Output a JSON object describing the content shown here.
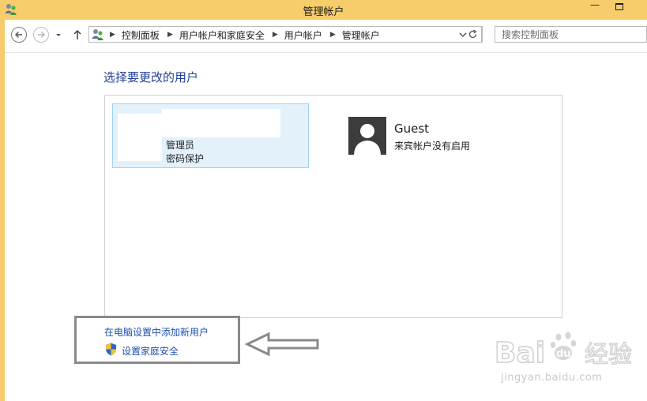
{
  "window": {
    "title": "管理帐户"
  },
  "breadcrumbs": [
    "控制面板",
    "用户帐户和家庭安全",
    "用户帐户",
    "管理帐户"
  ],
  "search": {
    "placeholder": "搜索控制面板"
  },
  "content": {
    "heading": "选择要更改的用户",
    "users": [
      {
        "name": "",
        "role": "管理员",
        "status": "密码保护",
        "selected": true
      },
      {
        "name": "Guest",
        "status": "来宾帐户没有启用",
        "selected": false
      }
    ]
  },
  "tasks": {
    "add_user": "在电脑设置中添加新用户",
    "family_safety": "设置家庭安全"
  },
  "watermark": {
    "logo_text": "Bai du 经验",
    "url": "jingyan.baidu.com"
  },
  "colors": {
    "titlebar": "#f7cd6c",
    "link": "#1f4fb0",
    "heading": "#1f3f95",
    "selected_tile": "#e3f1fb"
  },
  "icons": {
    "app": "user-accounts-icon",
    "back": "back-arrow-icon",
    "forward": "forward-arrow-icon",
    "up": "up-arrow-icon",
    "refresh": "refresh-icon",
    "shield": "uac-shield-icon"
  }
}
